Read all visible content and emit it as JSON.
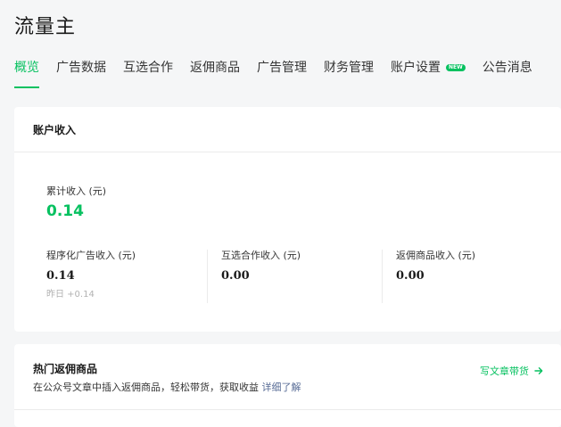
{
  "app": {
    "title": "流量主"
  },
  "tabs": [
    {
      "label": "概览",
      "active": true
    },
    {
      "label": "广告数据"
    },
    {
      "label": "互选合作"
    },
    {
      "label": "返佣商品"
    },
    {
      "label": "广告管理"
    },
    {
      "label": "财务管理"
    },
    {
      "label": "账户设置",
      "badge": "NEW"
    },
    {
      "label": "公告消息"
    }
  ],
  "income": {
    "title": "账户收入",
    "total_label": "累计收入 (元)",
    "total_value": "0.14",
    "items": [
      {
        "label": "程序化广告收入 (元)",
        "value": "0.14",
        "note": "昨日 +0.14"
      },
      {
        "label": "互选合作收入 (元)",
        "value": "0.00"
      },
      {
        "label": "返佣商品收入 (元)",
        "value": "0.00"
      }
    ]
  },
  "hot": {
    "title": "热门返佣商品",
    "desc": "在公众号文章中插入返佣商品，轻松带货，获取收益 ",
    "link": "详细了解",
    "action": "写文章带货"
  },
  "colors": {
    "accent": "#07c160",
    "link": "#576b95"
  }
}
